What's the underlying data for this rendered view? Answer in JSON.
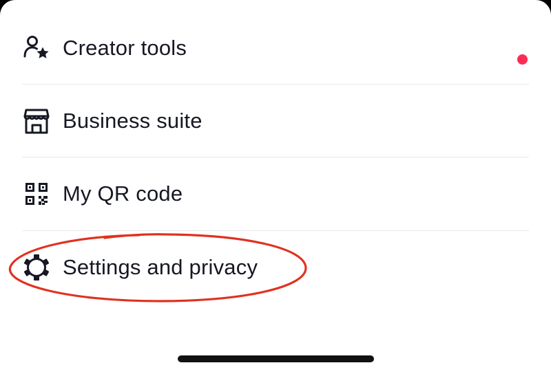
{
  "menu": {
    "items": [
      {
        "label": "Creator tools",
        "icon": "person-star-icon",
        "has_notification_dot": true
      },
      {
        "label": "Business suite",
        "icon": "storefront-icon"
      },
      {
        "label": "My QR code",
        "icon": "qr-code-icon"
      },
      {
        "label": "Settings and privacy",
        "icon": "gear-icon",
        "highlighted": true
      }
    ]
  },
  "colors": {
    "text": "#161823",
    "notification_dot": "#fe2c55",
    "highlight_ellipse": "#e0321f",
    "divider": "#e8e8ea",
    "home_indicator": "#111111"
  }
}
